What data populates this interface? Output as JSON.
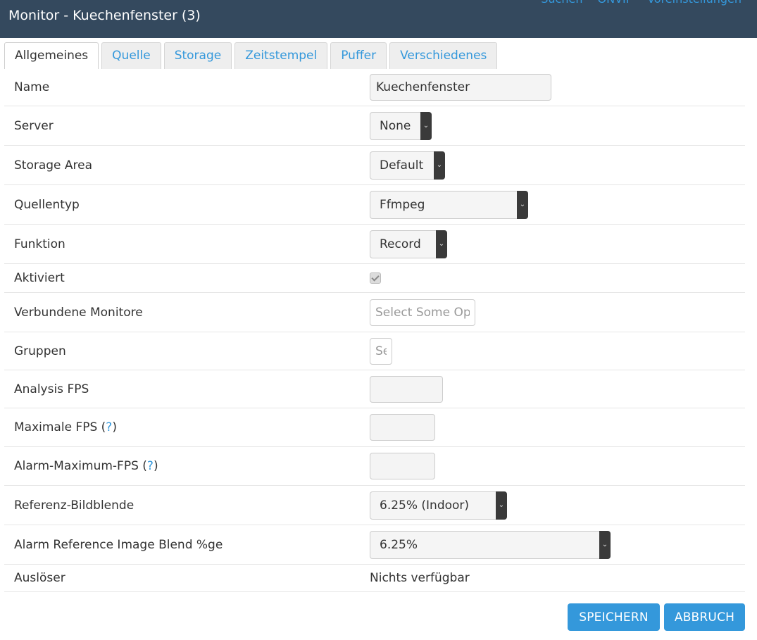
{
  "header": {
    "title": "Monitor - Kuechenfenster (3)",
    "links": [
      "Suchen",
      "ONVIF",
      "Voreinstellungen"
    ]
  },
  "tabs": [
    {
      "label": "Allgemeines",
      "active": true
    },
    {
      "label": "Quelle",
      "active": false
    },
    {
      "label": "Storage",
      "active": false
    },
    {
      "label": "Zeitstempel",
      "active": false
    },
    {
      "label": "Puffer",
      "active": false
    },
    {
      "label": "Verschiedenes",
      "active": false
    }
  ],
  "form": {
    "name": {
      "label": "Name",
      "value": "Kuechenfenster"
    },
    "server": {
      "label": "Server",
      "value": "None"
    },
    "storage_area": {
      "label": "Storage Area",
      "value": "Default"
    },
    "source_type": {
      "label": "Quellentyp",
      "value": "Ffmpeg"
    },
    "function": {
      "label": "Funktion",
      "value": "Record"
    },
    "enabled": {
      "label": "Aktiviert",
      "checked": true
    },
    "linked_monitors": {
      "label": "Verbundene Monitore",
      "placeholder": "Select Some Options"
    },
    "groups": {
      "label": "Gruppen",
      "placeholder": "Select Some Options"
    },
    "analysis_fps": {
      "label": "Analysis FPS",
      "value": ""
    },
    "max_fps": {
      "label": "Maximale FPS (",
      "help": "?",
      "suffix": ")",
      "value": ""
    },
    "alarm_max_fps": {
      "label": "Alarm-Maximum-FPS (",
      "help": "?",
      "suffix": ")",
      "value": ""
    },
    "ref_blend": {
      "label": "Referenz-Bildblende",
      "value": "6.25% (Indoor)"
    },
    "alarm_ref_blend": {
      "label": "Alarm Reference Image Blend %ge",
      "value": "6.25%"
    },
    "triggers": {
      "label": "Auslöser",
      "value": "Nichts verfügbar"
    }
  },
  "buttons": {
    "save": "SPEICHERN",
    "cancel": "ABBRUCH"
  },
  "colors": {
    "header_bg": "#34495e",
    "accent": "#3498db",
    "select_arrow_bg": "#3a3a3a"
  }
}
